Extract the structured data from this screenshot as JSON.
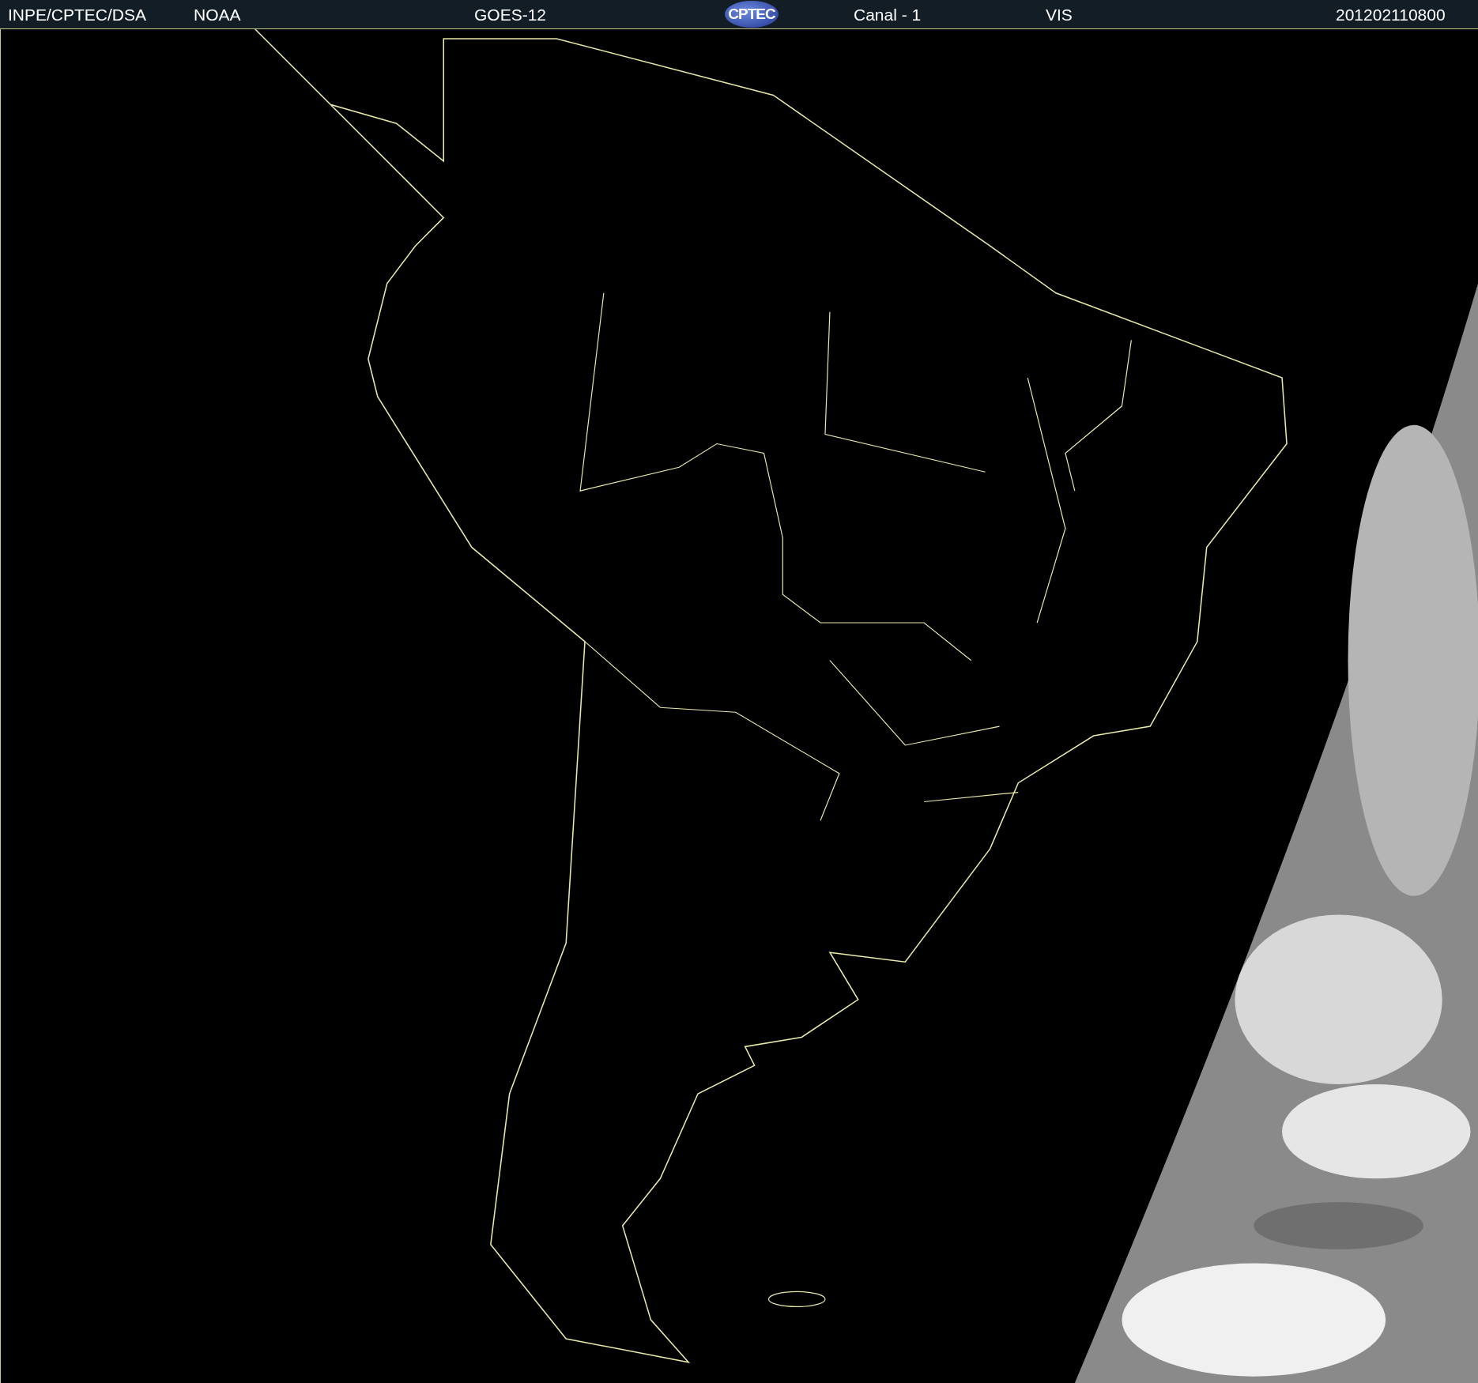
{
  "header": {
    "items": [
      {
        "kind": "text",
        "text": "INPE/CPTEC/DSA"
      },
      {
        "kind": "text",
        "text": "NOAA"
      },
      {
        "kind": "text",
        "text": "GOES-12"
      },
      {
        "kind": "logo",
        "text": "CPTEC"
      },
      {
        "kind": "text",
        "text": "Canal - 1"
      },
      {
        "kind": "text",
        "text": "VIS"
      },
      {
        "kind": "text",
        "text": "201202110800"
      }
    ]
  }
}
